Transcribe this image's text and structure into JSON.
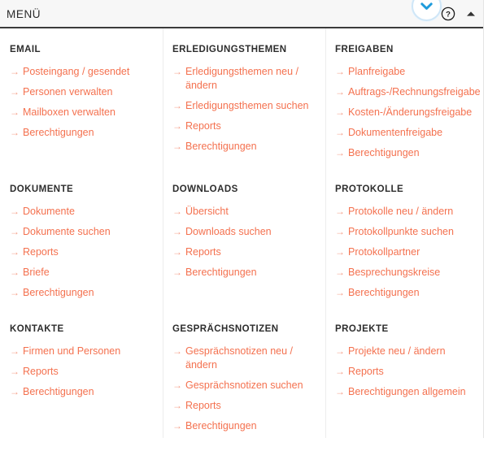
{
  "header": {
    "title": "MENÜ",
    "chevron_icon": "chevron-down-icon",
    "help_icon": "question-mark-circle-icon",
    "collapse_icon": "triangle-up-icon"
  },
  "theme": {
    "link_color": "#f4714f",
    "arrow_color": "#f5a18c",
    "heading_color": "#2d2d2d",
    "header_background": "#f7f7f7",
    "header_border": "#3b3b3b",
    "chevron_blue": "#1e9bdb"
  },
  "link_arrow": "→",
  "sections": [
    {
      "title": "EMAIL",
      "links": [
        "Posteingang / gesendet",
        "Personen verwalten",
        "Mailboxen verwalten",
        "Berechtigungen"
      ]
    },
    {
      "title": "ERLEDIGUNGSTHEMEN",
      "links": [
        "Erledigungsthemen neu / ändern",
        "Erledigungsthemen suchen",
        "Reports",
        "Berechtigungen"
      ]
    },
    {
      "title": "FREIGABEN",
      "links": [
        "Planfreigabe",
        "Auftrags-/Rechnungsfreigabe",
        "Kosten-/Änderungsfreigabe",
        "Dokumentenfreigabe",
        "Berechtigungen"
      ]
    },
    {
      "title": "DOKUMENTE",
      "links": [
        "Dokumente",
        "Dokumente suchen",
        "Reports",
        "Briefe",
        "Berechtigungen"
      ]
    },
    {
      "title": "DOWNLOADS",
      "links": [
        "Übersicht",
        "Downloads suchen",
        "Reports",
        "Berechtigungen"
      ]
    },
    {
      "title": "PROTOKOLLE",
      "links": [
        "Protokolle neu / ändern",
        "Protokollpunkte suchen",
        "Protokollpartner",
        "Besprechungskreise",
        "Berechtigungen"
      ]
    },
    {
      "title": "KONTAKTE",
      "links": [
        "Firmen und Personen",
        "Reports",
        "Berechtigungen"
      ]
    },
    {
      "title": "GESPRÄCHSNOTIZEN",
      "links": [
        "Gesprächsnotizen neu / ändern",
        "Gesprächsnotizen suchen",
        "Reports",
        "Berechtigungen"
      ]
    },
    {
      "title": "PROJEKTE",
      "links": [
        "Projekte neu / ändern",
        "Reports",
        "Berechtigungen allgemein"
      ]
    }
  ]
}
